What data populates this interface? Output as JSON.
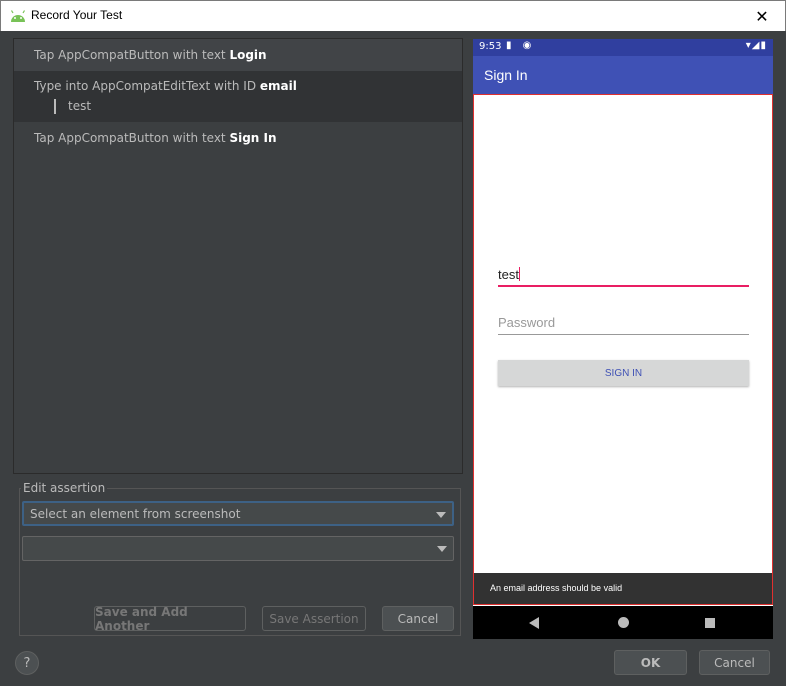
{
  "window": {
    "title": "Record Your Test",
    "close_glyph": "✕"
  },
  "steps": [
    {
      "prefix": "Tap AppCompatButton with text ",
      "target": "Login"
    },
    {
      "prefix": "Type into AppCompatEditText with ID ",
      "target": "email",
      "value": "test"
    },
    {
      "prefix": "Tap AppCompatButton with text ",
      "target": "Sign In"
    }
  ],
  "assertion": {
    "group_label": "Edit assertion",
    "element_select": "Select an element from screenshot",
    "assertion_select": "",
    "save_add_label": "Save and Add Another",
    "save_label": "Save Assertion",
    "cancel_label": "Cancel"
  },
  "footer": {
    "help_glyph": "?",
    "ok_label": "OK",
    "cancel_label": "Cancel"
  },
  "device": {
    "status_time": "9:53",
    "status_left_icons": "▮ ◉",
    "status_right_icons": "▾◢▮",
    "app_title": "Sign In",
    "email_value": "test",
    "password_hint": "Password",
    "signin_label": "SIGN IN",
    "snackbar_text": "An email address should be valid"
  },
  "colors": {
    "appbar": "#3f51b5",
    "statusbar": "#303f9f",
    "accent": "#e91e63",
    "highlight_border": "#e03030"
  }
}
